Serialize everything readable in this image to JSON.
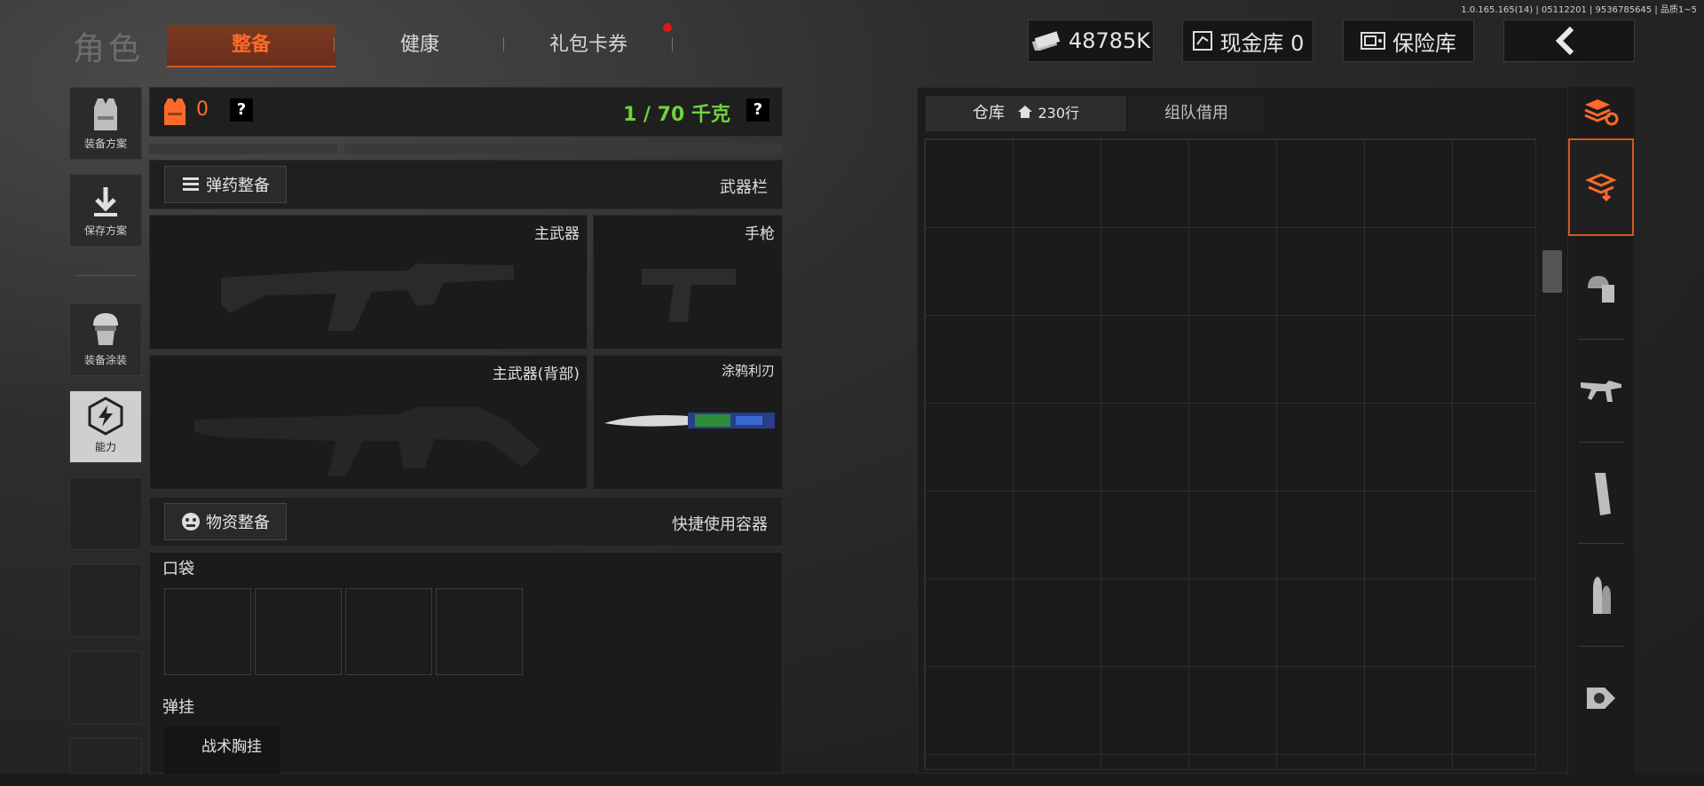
{
  "version": "1.0.165.165(14) | 05112201 | 9536785645 | 品质1~5",
  "header": {
    "title": "角色",
    "tabs": [
      {
        "label": "整备",
        "active": true
      },
      {
        "label": "健康",
        "active": false
      },
      {
        "label": "礼包卡券",
        "active": false,
        "badge": true
      }
    ],
    "currency": "48785K",
    "cash_vault": "现金库 0",
    "safe": "保险库"
  },
  "sidebar": {
    "items": [
      {
        "label": "装备方案",
        "icon": "vest-icon"
      },
      {
        "label": "保存方案",
        "icon": "download-icon"
      },
      {
        "label": "装备涂装",
        "icon": "soldier-helmet-icon"
      },
      {
        "label": "能力",
        "icon": "lightning-hex-icon"
      }
    ]
  },
  "loadout": {
    "armor_count": "0",
    "weight": "1 / 70 千克",
    "help": "?",
    "ammo_button": "弹药整备",
    "weapons_title": "武器栏",
    "primary": "主武器",
    "pistol": "手枪",
    "primary_back": "主武器(背部)",
    "melee": "涂鸦利刃",
    "supply_button": "物资整备",
    "quick_container": "快捷使用容器",
    "pockets": "口袋",
    "rig": "弹挂",
    "rig_item": "战术胸挂"
  },
  "warehouse": {
    "tab_storage": "仓库",
    "rows": "230行",
    "tab_team": "组队借用"
  },
  "colors": {
    "accent": "#ff6a2a",
    "weight_green": "#6fd23c",
    "badge_red": "#e01818"
  }
}
